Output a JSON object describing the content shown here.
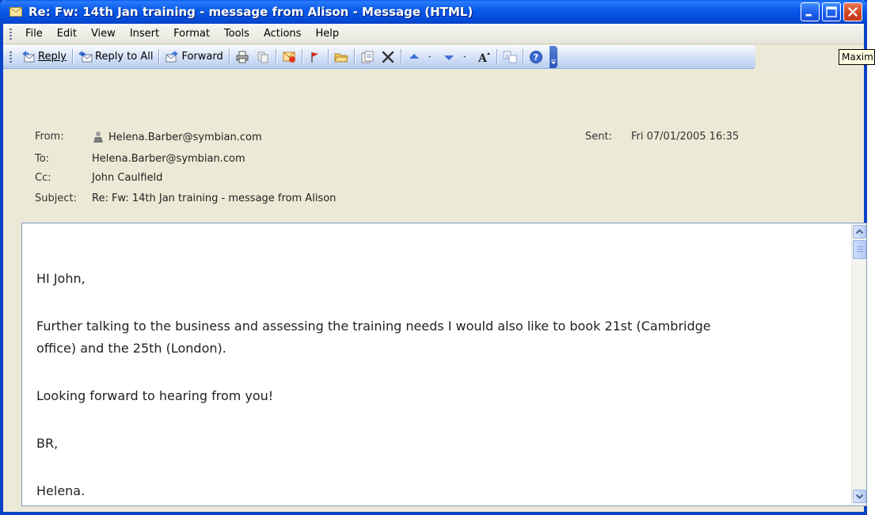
{
  "window": {
    "title": "Re: Fw: 14th Jan training - message from Alison - Message (HTML)"
  },
  "menu": [
    {
      "label": "File"
    },
    {
      "label": "Edit"
    },
    {
      "label": "View"
    },
    {
      "label": "Insert"
    },
    {
      "label": "Format"
    },
    {
      "label": "Tools"
    },
    {
      "label": "Actions"
    },
    {
      "label": "Help"
    }
  ],
  "toolbar": {
    "reply_label": "Reply",
    "reply_all_label": "Reply to All",
    "forward_label": "Forward"
  },
  "tooltip": {
    "text": "Maxim"
  },
  "header": {
    "from_label": "From:",
    "from_value": "Helena.Barber@symbian.com",
    "to_label": "To:",
    "to_value": "Helena.Barber@symbian.com",
    "cc_label": "Cc:",
    "cc_value": "John Caulfield",
    "subject_label": "Subject:",
    "subject_value": "Re: Fw: 14th Jan training - message from Alison",
    "sent_label": "Sent:",
    "sent_value": "Fri 07/01/2005 16:35"
  },
  "body": {
    "greeting": "HI John,",
    "paragraph_1_line_1": "Further talking to the business and assessing the training needs I would also like to book 21st (Cambridge",
    "paragraph_1_line_2": "office) and the 25th (London).",
    "paragraph_2": "Looking forward to hearing from you!",
    "signoff": "BR,",
    "signature": "Helena."
  },
  "colors": {
    "titlebar": "#0a5bea",
    "header_bg": "#ebead6",
    "toolbar": "#d6e3f8",
    "close_button": "#d2421c"
  }
}
